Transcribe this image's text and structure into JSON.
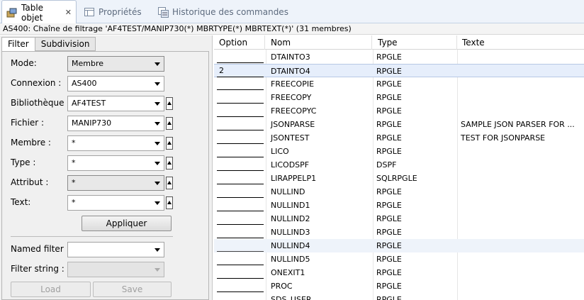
{
  "tabs": [
    {
      "label": "Table objet",
      "icon": "table-object-icon",
      "active": true,
      "closable": true
    },
    {
      "label": "Propriétés",
      "icon": "properties-icon",
      "active": false
    },
    {
      "label": "Historique des commandes",
      "icon": "command-history-icon",
      "active": false
    }
  ],
  "filter_string": "AS400: Chaîne de filtrage 'AF4TEST/MANIP730(*) MBRTYPE(*) MBRTEXT(*)' (31 membres)",
  "left_panel": {
    "subtabs": [
      "Filter",
      "Subdivision"
    ],
    "active_subtab": "Filter",
    "fields": {
      "mode": {
        "label": "Mode:",
        "value": "Membre"
      },
      "connexion": {
        "label": "Connexion :",
        "value": "AS400"
      },
      "bibliotheque": {
        "label": "Bibliothèque :",
        "value": "AF4TEST"
      },
      "fichier": {
        "label": "Fichier :",
        "value": "MANIP730"
      },
      "membre": {
        "label": "Membre :",
        "value": "*"
      },
      "type": {
        "label": "Type :",
        "value": "*"
      },
      "attribut": {
        "label": "Attribut :",
        "value": "*"
      },
      "text": {
        "label": "Text:",
        "value": "*"
      }
    },
    "apply_label": "Appliquer",
    "named_filter": {
      "label": "Named filter :",
      "value": ""
    },
    "filter_string_field": {
      "label": "Filter string :",
      "value": ""
    },
    "load_label": "Load",
    "save_label": "Save"
  },
  "table": {
    "columns": [
      "Option",
      "Nom",
      "Type",
      "Texte"
    ],
    "rows": [
      {
        "option": "",
        "nom": "DTAINTO3",
        "type": "RPGLE",
        "texte": ""
      },
      {
        "option": "2",
        "nom": "DTAINTO4",
        "type": "RPGLE",
        "texte": ""
      },
      {
        "option": "",
        "nom": "FREECOPIE",
        "type": "RPGLE",
        "texte": ""
      },
      {
        "option": "",
        "nom": "FREECOPY",
        "type": "RPGLE",
        "texte": ""
      },
      {
        "option": "",
        "nom": "FREECOPYC",
        "type": "RPGLE",
        "texte": ""
      },
      {
        "option": "",
        "nom": "JSONPARSE",
        "type": "RPGLE",
        "texte": "SAMPLE JSON PARSER FOR ..."
      },
      {
        "option": "",
        "nom": "JSONTEST",
        "type": "RPGLE",
        "texte": "TEST FOR JSONPARSE"
      },
      {
        "option": "",
        "nom": "LICO",
        "type": "RPGLE",
        "texte": ""
      },
      {
        "option": "",
        "nom": "LICODSPF",
        "type": "DSPF",
        "texte": ""
      },
      {
        "option": "",
        "nom": "LIRAPPELP1",
        "type": "SQLRPGLE",
        "texte": ""
      },
      {
        "option": "",
        "nom": "NULLIND",
        "type": "RPGLE",
        "texte": ""
      },
      {
        "option": "",
        "nom": "NULLIND1",
        "type": "RPGLE",
        "texte": ""
      },
      {
        "option": "",
        "nom": "NULLIND2",
        "type": "RPGLE",
        "texte": ""
      },
      {
        "option": "",
        "nom": "NULLIND3",
        "type": "RPGLE",
        "texte": ""
      },
      {
        "option": "",
        "nom": "NULLIND4",
        "type": "RPGLE",
        "texte": ""
      },
      {
        "option": "",
        "nom": "NULLIND5",
        "type": "RPGLE",
        "texte": ""
      },
      {
        "option": "",
        "nom": "ONEXIT1",
        "type": "RPGLE",
        "texte": ""
      },
      {
        "option": "",
        "nom": "PROC",
        "type": "RPGLE",
        "texte": ""
      },
      {
        "option": "",
        "nom": "SDS_USER",
        "type": "RPGLE",
        "texte": ""
      }
    ],
    "selected_row": 1,
    "hover_row": 14
  },
  "colors": {
    "selection": "#e6eefb",
    "tabbar": "#eef3fa"
  }
}
